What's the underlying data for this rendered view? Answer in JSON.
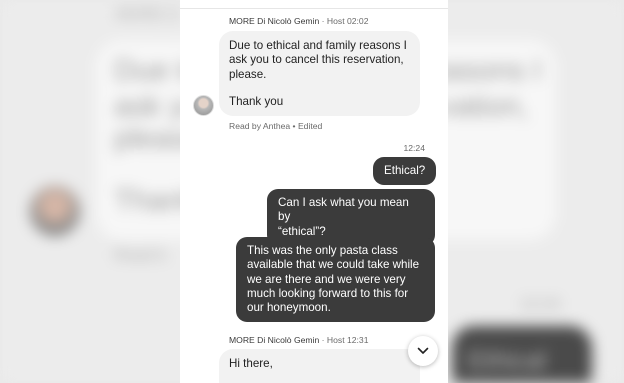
{
  "background": {
    "faint_top": "MORE D",
    "line_1": "Due to",
    "line_1b": "reasons I",
    "line_2": "ask you",
    "line_2b": "vation,",
    "line_3": "please",
    "line_4": "Thank",
    "read_label": "Read b",
    "time": "12:24",
    "dark_text": "Ethical"
  },
  "chat": {
    "messages": [
      {
        "sender": "MORE Di Nicolò Gemin",
        "meta": "· Host 02:02",
        "lines": [
          "Due to ethical and family reasons I",
          "ask you to cancel this reservation,",
          "please."
        ],
        "closing": "Thank you",
        "read_receipt": "Read by Anthea • Edited"
      },
      {
        "time": "12:24"
      },
      {
        "text": "Ethical?"
      },
      {
        "lines": [
          "Can I ask what you mean by",
          "“ethical”?"
        ]
      },
      {
        "lines": [
          "This was the only pasta class",
          "available that we could take while",
          "we are there and we were very",
          "much looking forward to this for",
          "our honeymoon."
        ]
      },
      {
        "sender": "MORE Di Nicolò Gemin",
        "meta": "· Host 12:31",
        "text": "Hi there,"
      }
    ]
  },
  "icons": {
    "avatar": "host-avatar",
    "scroll": "chevron-down-icon"
  }
}
